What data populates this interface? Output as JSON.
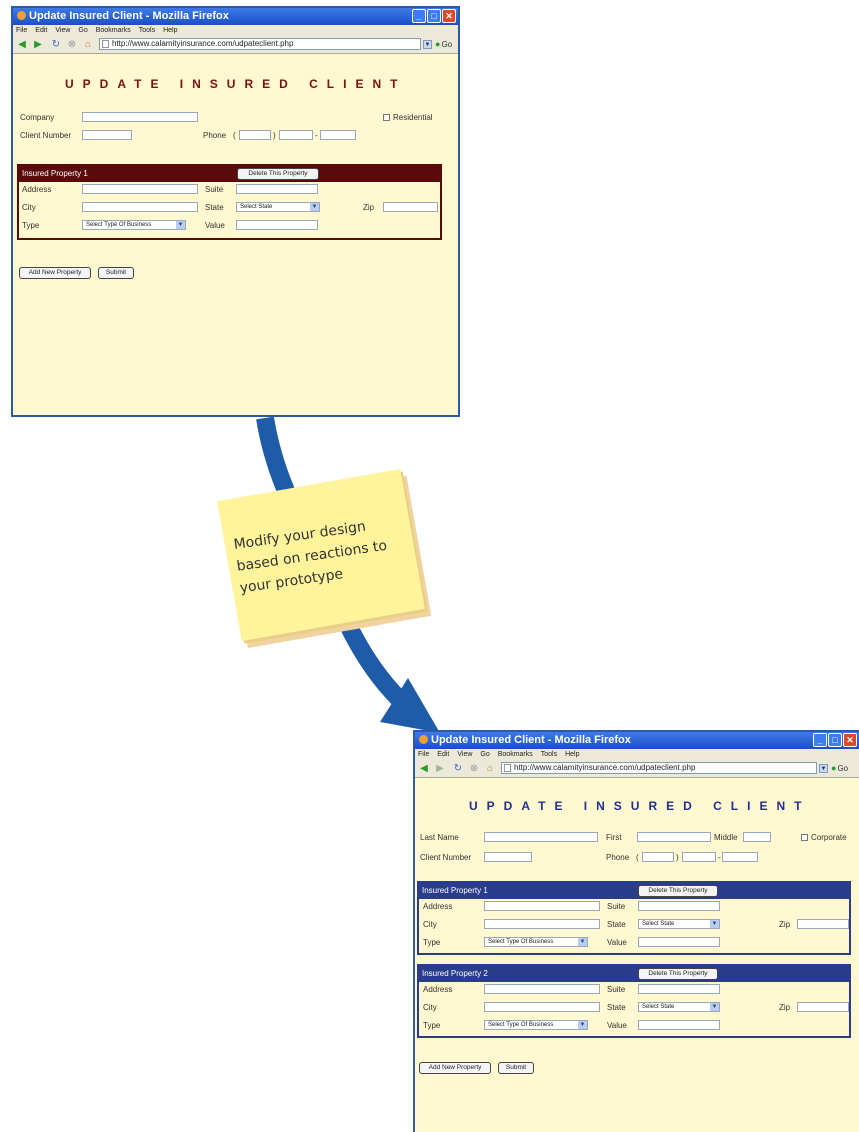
{
  "connector": {
    "color": "#1f5ca8"
  },
  "note": {
    "text": "Modify your design based on reactions to your prototype",
    "color": "#fff39c"
  },
  "windows": [
    {
      "title": "Update Insured Client - Mozilla Firefox",
      "menu": [
        "File",
        "Edit",
        "View",
        "Go",
        "Bookmarks",
        "Tools",
        "Help"
      ],
      "url": "http://www.calamityinsurance.com/udpateclient.php",
      "go_label": "Go",
      "heading": "UPDATE INSURED CLIENT",
      "heading_color": "#7a1010",
      "fields": {
        "company_label": "Company",
        "residential_label": "Residential",
        "client_number_label": "Client Number",
        "phone_label": "Phone",
        "phone_open": "(",
        "phone_close": ")",
        "phone_dash": "-"
      },
      "properties": [
        {
          "title": "Insured Property 1",
          "delete_label": "Delete This Property",
          "address_label": "Address",
          "suite_label": "Suite",
          "city_label": "City",
          "state_label": "State",
          "state_value": "Select State",
          "zip_label": "Zip",
          "type_label": "Type",
          "type_value": "Select Type Of Business",
          "value_label": "Value"
        }
      ],
      "property_color": "#5a0a0a",
      "add_label": "Add New Property",
      "submit_label": "Submit"
    },
    {
      "title": "Update Insured Client - Mozilla Firefox",
      "menu": [
        "File",
        "Edit",
        "View",
        "Go",
        "Bookmarks",
        "Tools",
        "Help"
      ],
      "url": "http://www.calamityinsurance.com/udpateclient.php",
      "go_label": "Go",
      "heading": "UPDATE INSURED CLIENT",
      "heading_color": "#1f2f90",
      "fields": {
        "last_name_label": "Last Name",
        "first_label": "First",
        "middle_label": "Middle",
        "corporate_label": "Corporate",
        "client_number_label": "Client Number",
        "phone_label": "Phone",
        "phone_open": "(",
        "phone_close": ")",
        "phone_dash": "-"
      },
      "properties": [
        {
          "title": "Insured Property 1",
          "delete_label": "Delete This Property",
          "address_label": "Address",
          "suite_label": "Suite",
          "city_label": "City",
          "state_label": "State",
          "state_value": "Select State",
          "zip_label": "Zip",
          "type_label": "Type",
          "type_value": "Select Type Of Business",
          "value_label": "Value"
        },
        {
          "title": "Insured Property 2",
          "delete_label": "Delete This Property",
          "address_label": "Address",
          "suite_label": "Suite",
          "city_label": "City",
          "state_label": "State",
          "state_value": "Select State",
          "zip_label": "Zip",
          "type_label": "Type",
          "type_value": "Select Type Of Business",
          "value_label": "Value"
        }
      ],
      "property_color": "#2a3c8c",
      "add_label": "Add New Property",
      "submit_label": "Submit"
    }
  ]
}
